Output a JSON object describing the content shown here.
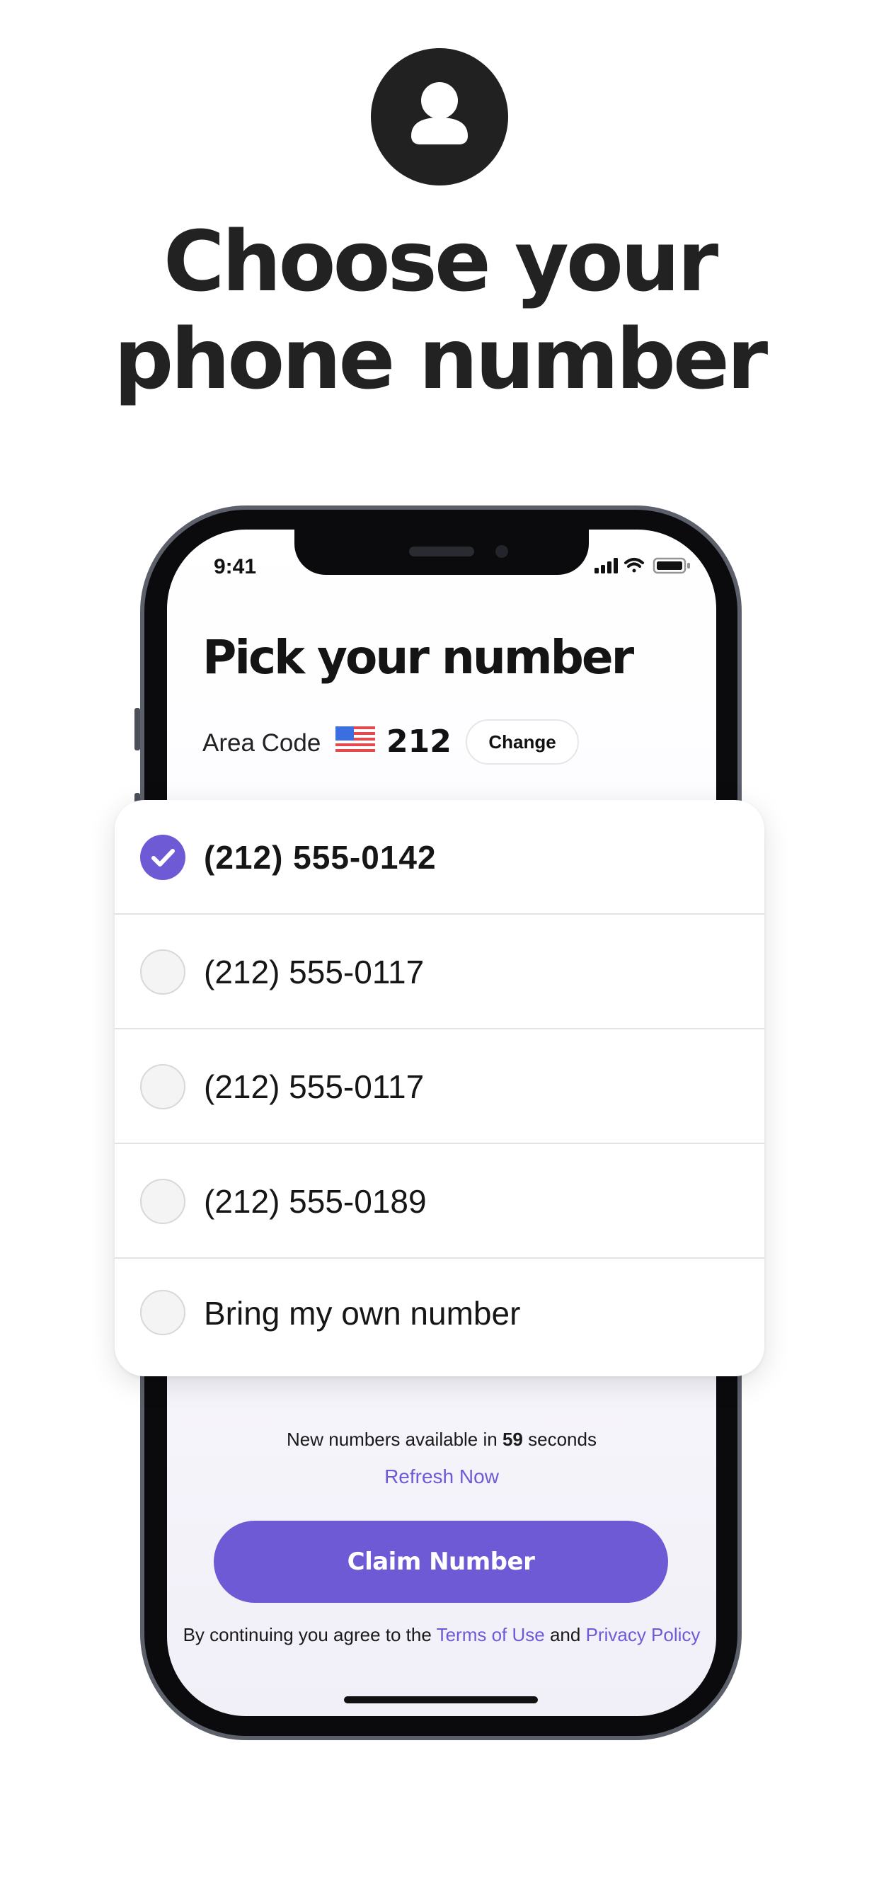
{
  "icons": {
    "profile": "person-icon",
    "signal": "cellular-signal-icon",
    "wifi": "wifi-icon",
    "battery": "battery-icon",
    "flag": "us-flag-icon",
    "check": "checkmark-icon"
  },
  "headline": {
    "line1": "Choose your",
    "line2": "phone number"
  },
  "status_bar": {
    "time": "9:41"
  },
  "screen": {
    "title": "Pick your number",
    "area_code_label": "Area Code",
    "area_code": "212",
    "change_label": "Change"
  },
  "options": [
    {
      "label": "(212) 555-0142",
      "selected": true
    },
    {
      "label": "(212) 555-0117",
      "selected": false
    },
    {
      "label": "(212) 555-0117",
      "selected": false
    },
    {
      "label": "(212) 555-0189",
      "selected": false
    },
    {
      "label": "Bring my own number",
      "selected": false
    }
  ],
  "timer": {
    "prefix": "New numbers available in",
    "seconds": "59",
    "suffix": "seconds"
  },
  "refresh_label": "Refresh Now",
  "claim_label": "Claim Number",
  "terms": {
    "prefix": "By continuing you agree to the",
    "terms_link": "Terms of Use",
    "conjunction": "and",
    "privacy_link": "Privacy Policy"
  },
  "colors": {
    "accent": "#6f5ad6",
    "dark": "#212121"
  }
}
